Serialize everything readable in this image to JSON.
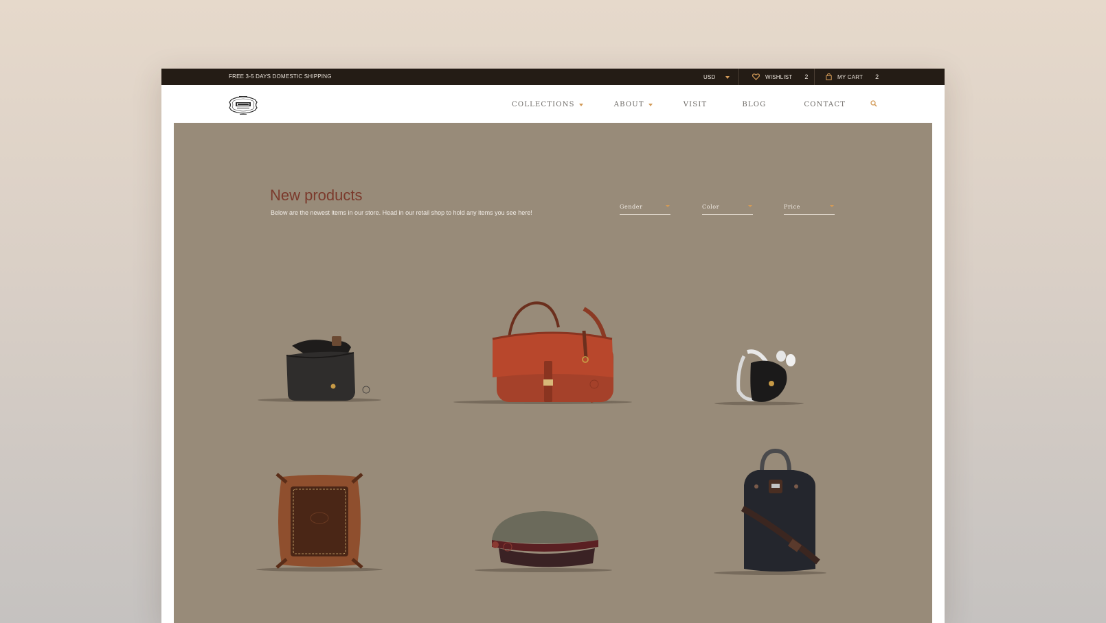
{
  "topbar": {
    "shipping": "FREE 3-5 DAYS DOMESTIC SHIPPING",
    "currency": "USD",
    "wishlist_label": "WISHLIST",
    "wishlist_count": "2",
    "cart_label": "MY CART",
    "cart_count": "2"
  },
  "nav": {
    "items": [
      {
        "label": "COLLECTIONS",
        "has_dropdown": true
      },
      {
        "label": "ABOUT",
        "has_dropdown": true
      },
      {
        "label": "VISIT",
        "has_dropdown": false
      },
      {
        "label": "BLOG",
        "has_dropdown": false
      },
      {
        "label": "CONTACT",
        "has_dropdown": false
      }
    ]
  },
  "hero": {
    "title": "New products",
    "subtitle": "Below are the newest items in our store. Head in our retail shop to hold any items you see here!",
    "filters": [
      {
        "label": "Gender"
      },
      {
        "label": "Color"
      },
      {
        "label": "Price"
      }
    ]
  },
  "products": [
    {
      "name": "glasses-case"
    },
    {
      "name": "red-saddle-bag"
    },
    {
      "name": "earbud-holder"
    },
    {
      "name": "leather-tray"
    },
    {
      "name": "canvas-cap"
    },
    {
      "name": "canvas-backpack"
    }
  ],
  "colors": {
    "topbar_bg": "#241c15",
    "hero_bg": "#988b79",
    "accent": "#d29a57",
    "title": "#7b3a2c"
  }
}
